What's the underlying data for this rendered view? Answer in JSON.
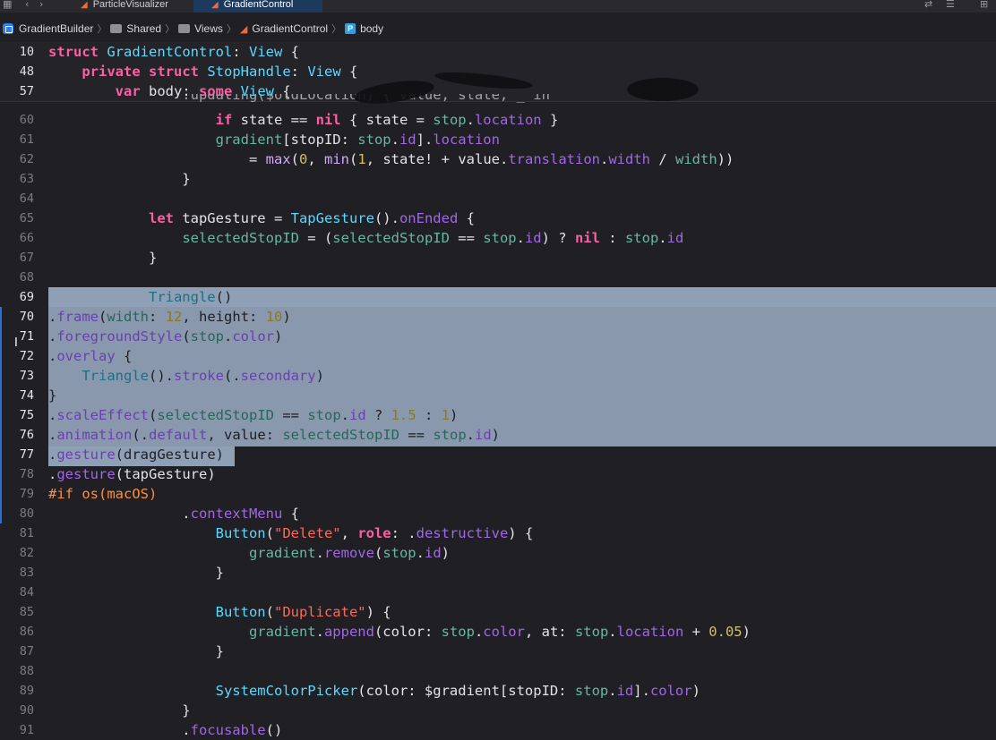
{
  "tabbar": {
    "tabs": [
      {
        "label": "ParticleVisualizer",
        "active": false
      },
      {
        "label": "GradientControl",
        "active": true
      }
    ]
  },
  "breadcrumb": [
    "GradientBuilder",
    "Shared",
    "Views",
    "GradientControl",
    "body"
  ],
  "sticky_lines": [
    {
      "num": "10",
      "text": "struct GradientControl: View {"
    },
    {
      "num": "48",
      "text": "    private struct StopHandle: View {"
    },
    {
      "num": "57",
      "text": "        var body: some View {"
    }
  ],
  "code_lines": [
    {
      "num": "60",
      "text": "                    if state == nil { state = stop.location }"
    },
    {
      "num": "61",
      "text": "                    gradient[stopID: stop.id].location"
    },
    {
      "num": "62",
      "text": "                        = max(0, min(1, state! + value.translation.width / width))"
    },
    {
      "num": "63",
      "text": "                }"
    },
    {
      "num": "64",
      "text": ""
    },
    {
      "num": "65",
      "text": "            let tapGesture = TapGesture().onEnded {"
    },
    {
      "num": "66",
      "text": "                selectedStopID = (selectedStopID == stop.id) ? nil : stop.id"
    },
    {
      "num": "67",
      "text": "            }"
    },
    {
      "num": "68",
      "text": ""
    },
    {
      "num": "69",
      "text": "            Triangle()"
    },
    {
      "num": "70",
      "text": ".frame(width: 12, height: 10)"
    },
    {
      "num": "71",
      "text": ".foregroundStyle(stop.color)"
    },
    {
      "num": "72",
      "text": ".overlay {"
    },
    {
      "num": "73",
      "text": "    Triangle().stroke(.secondary)"
    },
    {
      "num": "74",
      "text": "}"
    },
    {
      "num": "75",
      "text": ".scaleEffect(selectedStopID == stop.id ? 1.5 : 1)"
    },
    {
      "num": "76",
      "text": ".animation(.default, value: selectedStopID == stop.id)"
    },
    {
      "num": "77",
      "text": ".gesture(dragGesture)"
    },
    {
      "num": "78",
      "text": ".gesture(tapGesture)"
    },
    {
      "num": "79",
      "text": "#if os(macOS)"
    },
    {
      "num": "80",
      "text": "                .contextMenu {"
    },
    {
      "num": "81",
      "text": "                    Button(\"Delete\", role: .destructive) {"
    },
    {
      "num": "82",
      "text": "                        gradient.remove(stop.id)"
    },
    {
      "num": "83",
      "text": "                    }"
    },
    {
      "num": "84",
      "text": ""
    },
    {
      "num": "85",
      "text": "                    Button(\"Duplicate\") {"
    },
    {
      "num": "86",
      "text": "                        gradient.append(color: stop.color, at: stop.location + 0.05)"
    },
    {
      "num": "87",
      "text": "                    }"
    },
    {
      "num": "88",
      "text": ""
    },
    {
      "num": "89",
      "text": "                    SystemColorPicker(color: $gradient[stopID: stop.id].color)"
    },
    {
      "num": "90",
      "text": "                }"
    },
    {
      "num": "91",
      "text": "                .focusable()"
    }
  ],
  "colors": {
    "background": "#1f1f24",
    "selection": "#8f9fb5",
    "keyword": "#fc5fa3",
    "type": "#5dd8ff",
    "string": "#fc6a5d",
    "number": "#d0bf69",
    "preprocessor": "#fd8f3f"
  }
}
